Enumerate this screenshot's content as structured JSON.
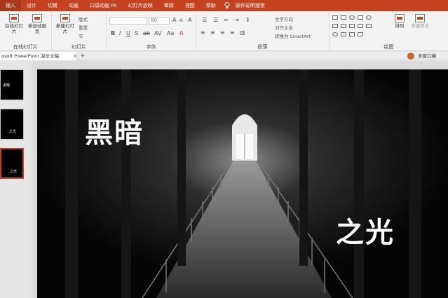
{
  "menu": {
    "tabs": [
      "插入",
      "设计",
      "切换",
      "动画",
      "口袋动画 PA",
      "幻灯片放映",
      "审阅",
      "视图",
      "帮助"
    ],
    "search_label": "操作说明搜索"
  },
  "ribbon": {
    "slides_group": {
      "label": "幻灯片",
      "from_beginning": "在线幻灯片",
      "add_animation": "新加动画页",
      "new_slide": "新建幻灯片",
      "layout": "版式",
      "reset": "重置",
      "section": "节",
      "online_group_label": "在线幻灯片"
    },
    "font_group": {
      "label": "字体",
      "size": "80"
    },
    "paragraph_group": {
      "label": "段落",
      "text_direction": "文字方向",
      "align_text": "对齐文本",
      "smartart": "转换为 SmartArt"
    },
    "drawing_group": {
      "label": "绘图",
      "arrange": "排列",
      "quick_styles": "快速样式"
    }
  },
  "doc_tab": {
    "title": "osoft PowerPoint 演示文稿",
    "close": "×",
    "new": "+"
  },
  "collab_label": "多窗口横",
  "thumbnails": [
    {
      "text": "黑暗"
    },
    {
      "text": "之光"
    },
    {
      "text": "之光"
    }
  ],
  "slide": {
    "title_dark": "黑暗",
    "title_light": "之光"
  },
  "colors": {
    "accent": "#c4421f"
  }
}
